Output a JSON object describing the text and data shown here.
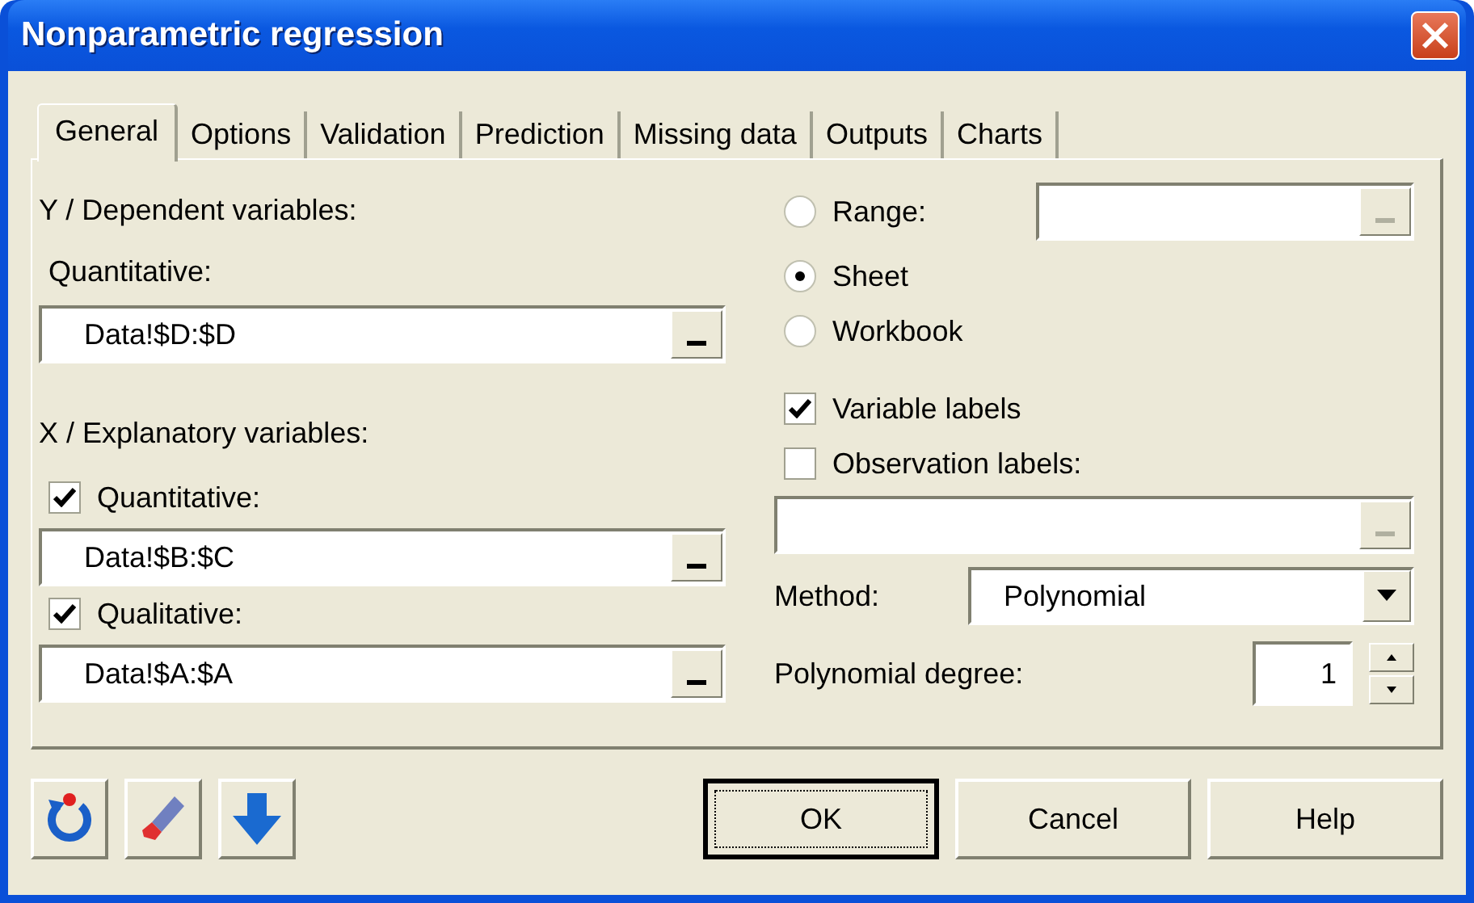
{
  "window": {
    "title": "Nonparametric regression"
  },
  "tabs": [
    {
      "label": "General",
      "selected": true
    },
    {
      "label": "Options",
      "selected": false
    },
    {
      "label": "Validation",
      "selected": false
    },
    {
      "label": "Prediction",
      "selected": false
    },
    {
      "label": "Missing data",
      "selected": false
    },
    {
      "label": "Outputs",
      "selected": false
    },
    {
      "label": "Charts",
      "selected": false
    }
  ],
  "y_variables": {
    "heading": "Y / Dependent variables:",
    "label": "Quantitative:",
    "value": "Data!$D:$D"
  },
  "x_variables": {
    "heading": "X / Explanatory variables:",
    "items": [
      {
        "label": "Quantitative:",
        "checked": true,
        "value": "Data!$B:$C"
      },
      {
        "label": "Qualitative:",
        "checked": true,
        "value": "Data!$A:$A"
      }
    ]
  },
  "output_location": [
    {
      "label": "Range:",
      "selected": false
    },
    {
      "label": "Sheet",
      "selected": true
    },
    {
      "label": "Workbook",
      "selected": false
    }
  ],
  "labels": [
    {
      "label": "Variable labels",
      "checked": true
    },
    {
      "label": "Observation labels:",
      "checked": false
    }
  ],
  "method": {
    "label": "Method:",
    "value": "Polynomial"
  },
  "degree": {
    "label": "Polynomial degree:",
    "value": "1"
  },
  "buttons": [
    {
      "label": "OK",
      "default": true
    },
    {
      "label": "Cancel",
      "default": false
    },
    {
      "label": "Help",
      "default": false
    }
  ]
}
